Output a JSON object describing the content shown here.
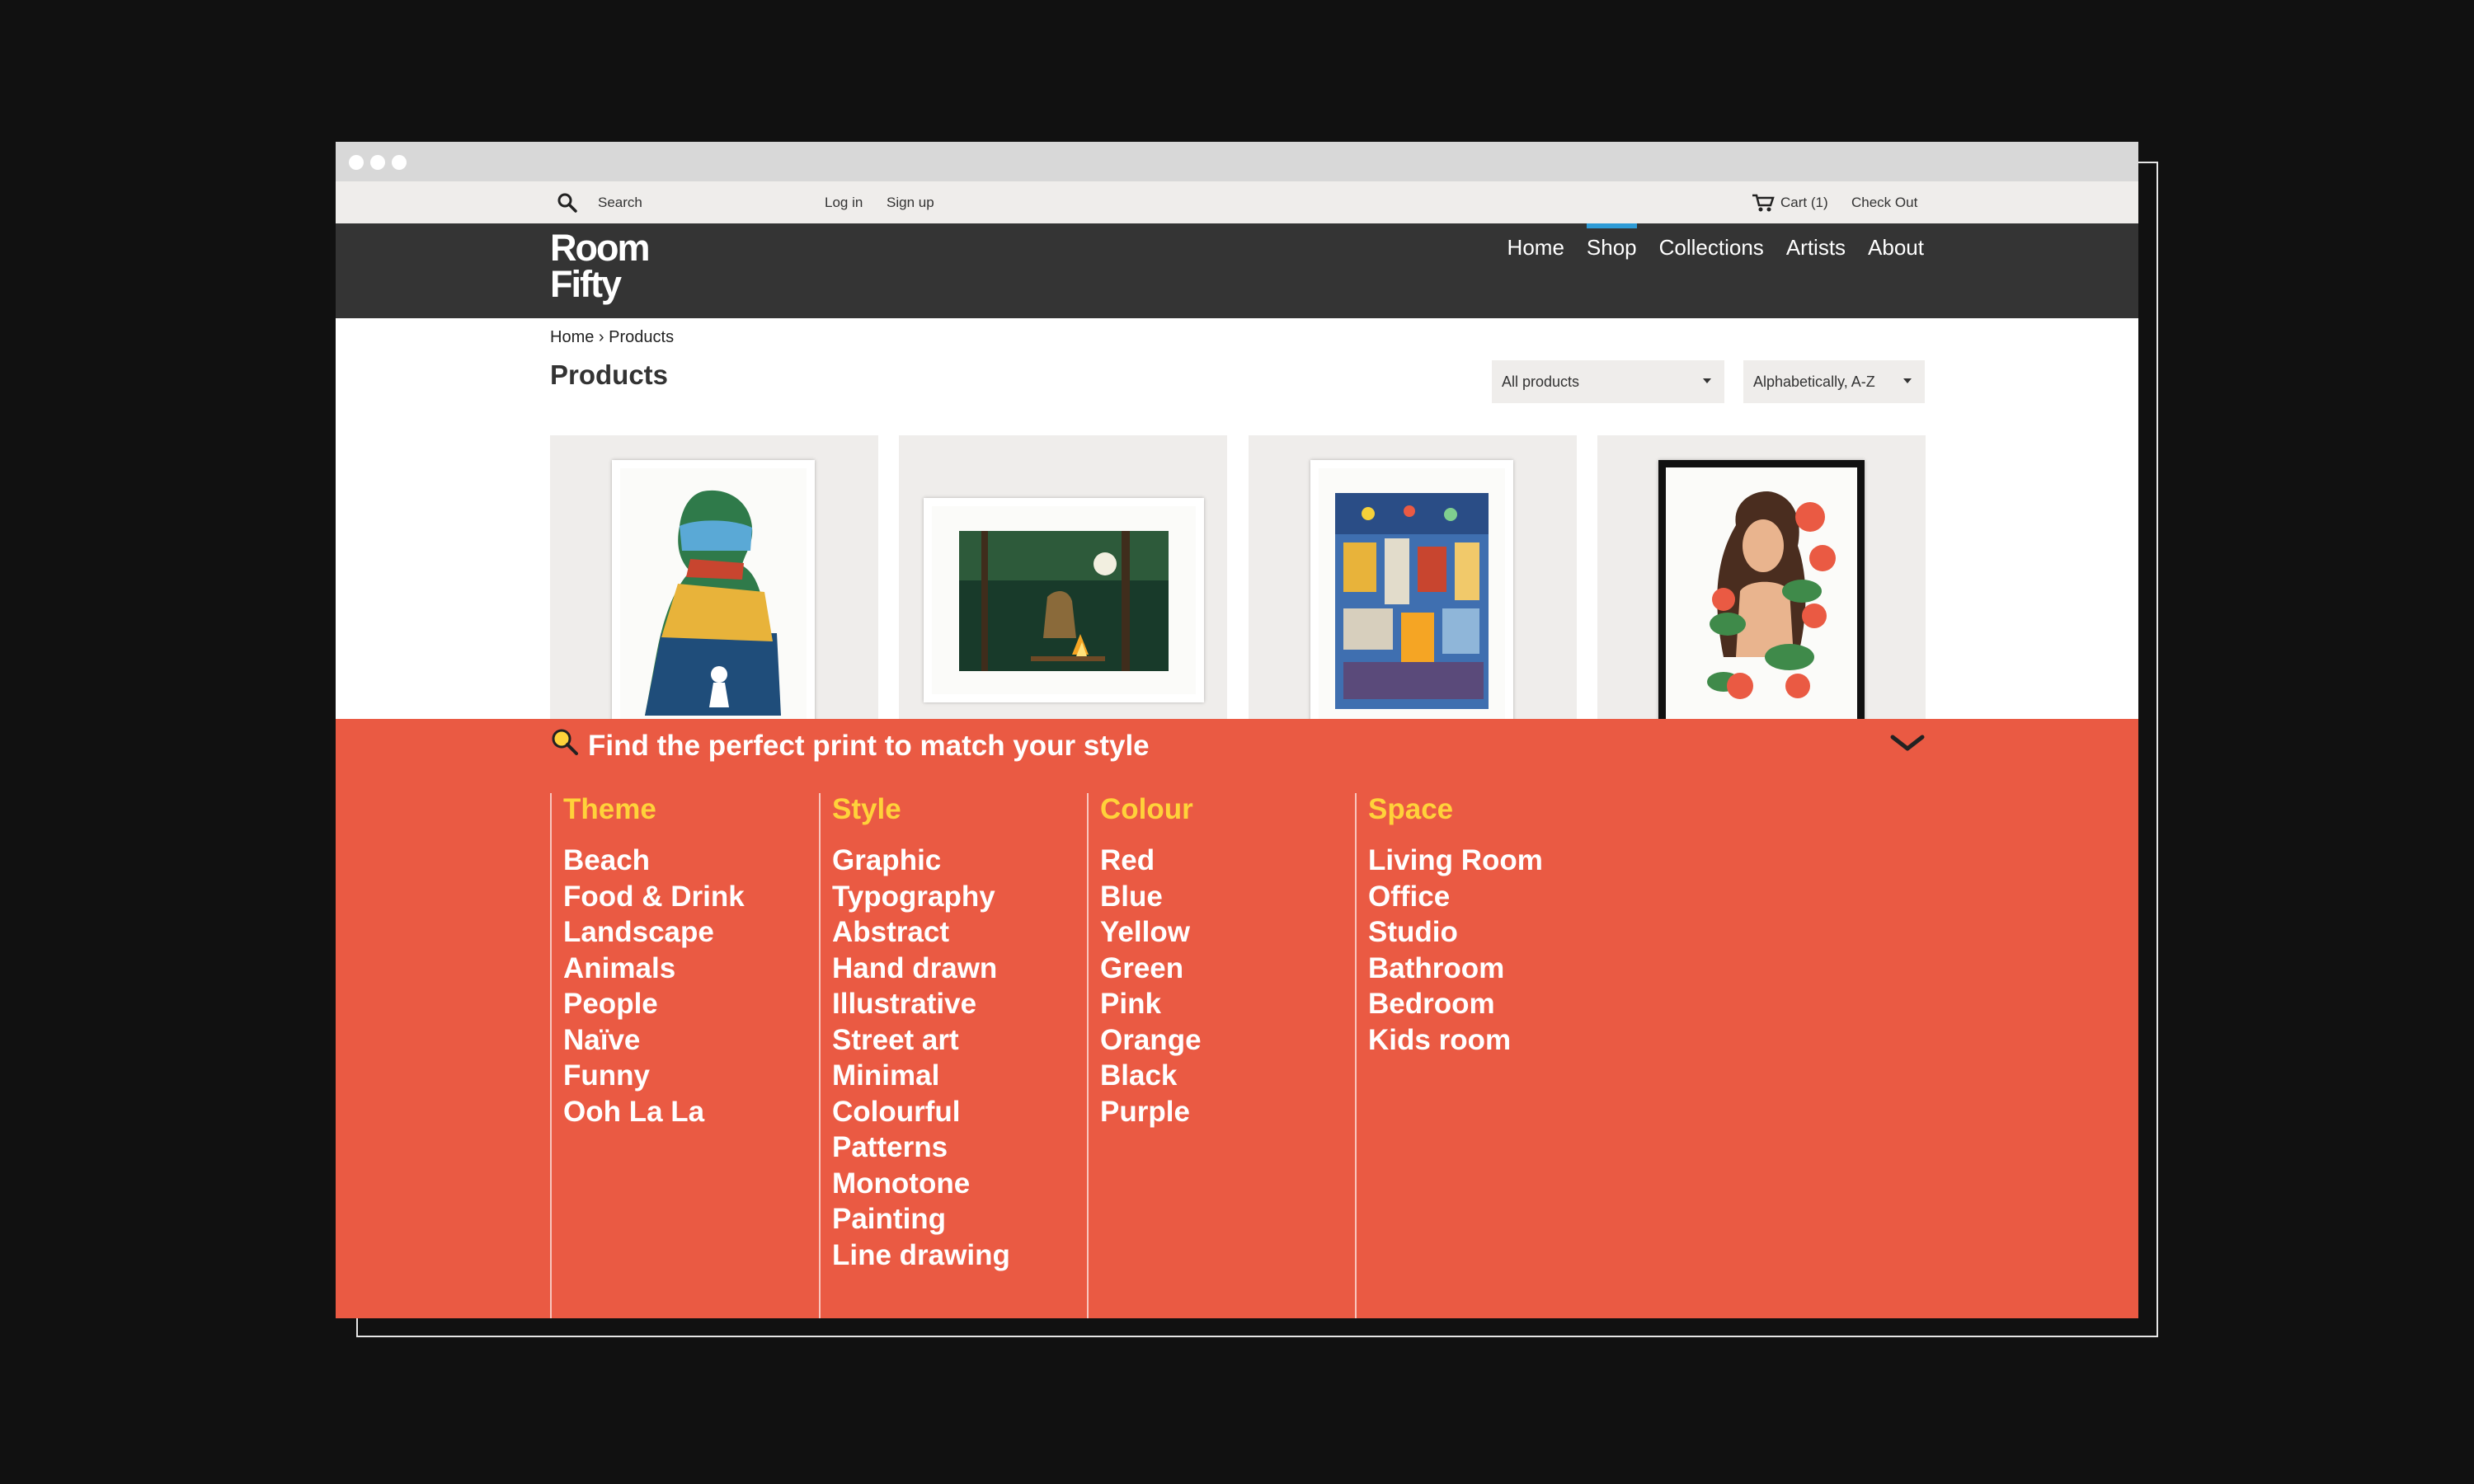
{
  "utility": {
    "search_placeholder": "Search",
    "login": "Log in",
    "signup": "Sign up",
    "cart": "Cart (1)",
    "checkout": "Check Out"
  },
  "brand": {
    "line1": "Room",
    "line2": "Fifty"
  },
  "nav": [
    {
      "label": "Home",
      "active": false
    },
    {
      "label": "Shop",
      "active": true
    },
    {
      "label": "Collections",
      "active": false
    },
    {
      "label": "Artists",
      "active": false
    },
    {
      "label": "About",
      "active": false
    }
  ],
  "breadcrumb": {
    "home": "Home",
    "sep": "›",
    "current": "Products"
  },
  "page_title": "Products",
  "filters": {
    "category": "All products",
    "sort": "Alphabetically, A-Z"
  },
  "finder": {
    "title": "Find the perfect print to match your style",
    "columns": [
      {
        "title": "Theme",
        "items": [
          "Beach",
          "Food & Drink",
          "Landscape",
          "Animals",
          "People",
          "Naïve",
          "Funny",
          "Ooh La La"
        ]
      },
      {
        "title": "Style",
        "items": [
          "Graphic",
          "Typography",
          "Abstract",
          "Hand drawn",
          "Illustrative",
          "Street art",
          "Minimal",
          "Colourful",
          "Patterns",
          "Monotone",
          "Painting",
          "Line drawing"
        ]
      },
      {
        "title": "Colour",
        "items": [
          "Red",
          "Blue",
          "Yellow",
          "Green",
          "Pink",
          "Orange",
          "Black",
          "Purple"
        ]
      },
      {
        "title": "Space",
        "items": [
          "Living Room",
          "Office",
          "Studio",
          "Bathroom",
          "Bedroom",
          "Kids room"
        ]
      }
    ]
  },
  "colors": {
    "accent": "#ea5a43",
    "highlight": "#ffd23a",
    "nav_active": "#2e9bd6",
    "header_bg": "#343434"
  }
}
